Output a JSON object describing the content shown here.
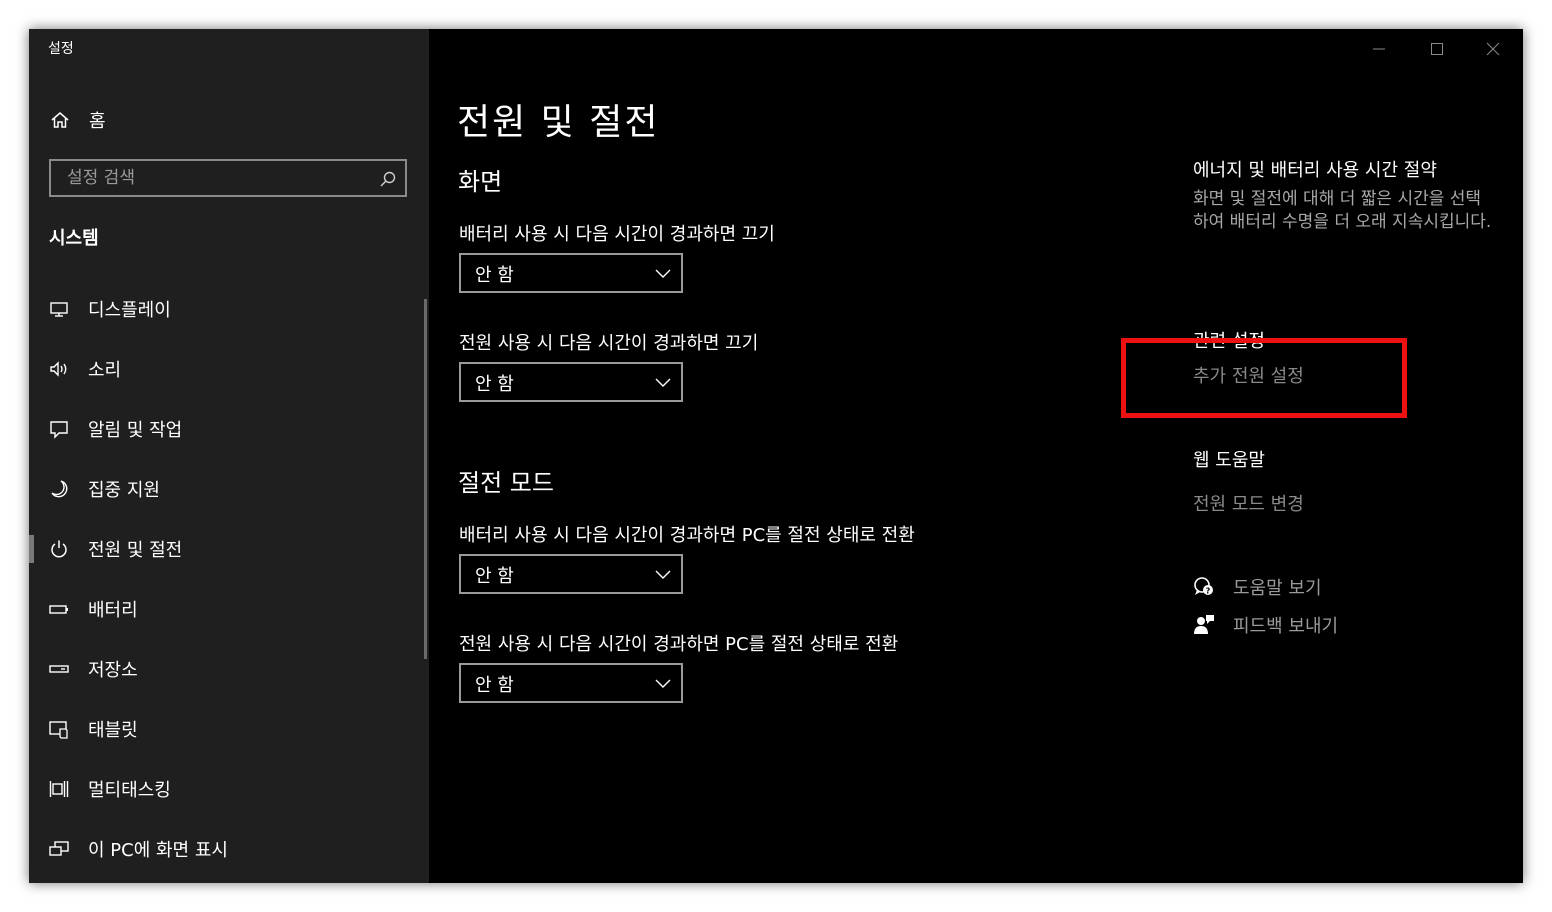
{
  "window": {
    "title": "설정",
    "controls": {
      "minimize": "minimize-icon",
      "maximize": "maximize-icon",
      "close": "close-icon"
    }
  },
  "sidebar": {
    "home_label": "홈",
    "search_placeholder": "설정 검색",
    "section_title": "시스템",
    "items": [
      {
        "label": "디스플레이",
        "icon": "display-icon"
      },
      {
        "label": "소리",
        "icon": "speaker-icon"
      },
      {
        "label": "알림 및 작업",
        "icon": "notification-icon"
      },
      {
        "label": "집중 지원",
        "icon": "moon-icon"
      },
      {
        "label": "전원 및 절전",
        "icon": "power-icon",
        "selected": true
      },
      {
        "label": "배터리",
        "icon": "battery-icon"
      },
      {
        "label": "저장소",
        "icon": "storage-icon"
      },
      {
        "label": "태블릿",
        "icon": "tablet-icon"
      },
      {
        "label": "멀티태스킹",
        "icon": "multitasking-icon"
      },
      {
        "label": "이 PC에 화면 표시",
        "icon": "project-icon"
      }
    ]
  },
  "main": {
    "page_title": "전원 및 절전",
    "screen": {
      "heading": "화면",
      "battery_label": "배터리 사용 시 다음 시간이 경과하면 끄기",
      "battery_value": "안 함",
      "plugged_label": "전원 사용 시 다음 시간이 경과하면 끄기",
      "plugged_value": "안 함"
    },
    "sleep": {
      "heading": "절전 모드",
      "battery_label": "배터리 사용 시 다음 시간이 경과하면 PC를 절전 상태로 전환",
      "battery_value": "안 함",
      "plugged_label": "전원 사용 시 다음 시간이 경과하면 PC를 절전 상태로 전환",
      "plugged_value": "안 함"
    }
  },
  "aside": {
    "energy_title": "에너지 및 배터리 사용 시간 절약",
    "energy_desc": "화면 및 절전에 대해 더 짧은 시간을 선택하여 배터리 수명을 더 오래 지속시킵니다.",
    "related_title": "관련 설정",
    "related_link": "추가 전원 설정",
    "web_help_title": "웹 도움말",
    "web_help_link": "전원 모드 변경",
    "get_help": "도움말 보기",
    "feedback": "피드백 보내기"
  },
  "colors": {
    "sidebar_bg": "#1f1f1f",
    "main_bg": "#000000",
    "highlight": "#ee1111"
  }
}
